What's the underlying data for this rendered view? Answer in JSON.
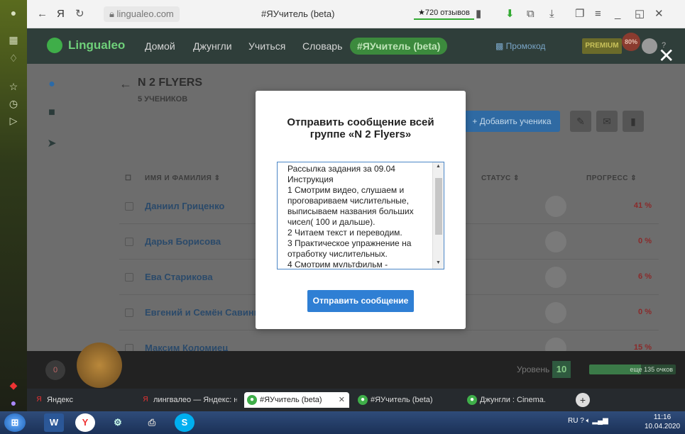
{
  "browser": {
    "url": "lingualeo.com",
    "page_title": "#ЯУчитель (beta)",
    "reviews": "★720 отзывов"
  },
  "nav": {
    "logo": "Lingualeo",
    "links": [
      "Домой",
      "Джунгли",
      "Учиться",
      "Словарь"
    ],
    "teacher": "#ЯУчитель (beta)",
    "promo": "Промокод",
    "premium": "PREMIUM",
    "premium_badge": "80%",
    "help": "?"
  },
  "group": {
    "title": "N 2 FLYERS",
    "subtitle": "5 УЧЕНИКОВ",
    "add_button": "+ Добавить ученика"
  },
  "table": {
    "headers": {
      "name": "ИМЯ И ФАМИЛИЯ",
      "status": "СТАТУС",
      "progress": "ПРОГРЕСС"
    },
    "rows": [
      {
        "name": "Даниил Гриценко",
        "progress": "41 %"
      },
      {
        "name": "Дарья Борисова",
        "progress": "0 %"
      },
      {
        "name": "Ева Старикова",
        "progress": "6 %"
      },
      {
        "name": "Евгений и Семён Савины",
        "progress": "0 %"
      },
      {
        "name": "Максим Коломиец",
        "progress": "15 %"
      }
    ]
  },
  "footer": {
    "zero": "0",
    "level_label": "Уровень",
    "level": "10",
    "progress_text": "еще 135 очков",
    "progress_fraction": 0.6
  },
  "modal": {
    "title": "Отправить сообщение всей группе «N 2 Flyers»",
    "message": "Рассылка задания за 09.04\nИнструкция\n1 Смотрим видео, слушаем и проговариваем числительные, выписываем названия больших чисел( 100 и дальше).\n2 Читаем текст и переводим.\n3 Практическое упражнение на отработку числительных.\n4 Смотрим мультфильм -",
    "send_button": "Отправить сообщение"
  },
  "tabs": [
    {
      "label": "Яндекс",
      "icon": "yandex-icon"
    },
    {
      "label": "лингвалео — Яндекс: нашлось",
      "icon": "yandex-icon"
    },
    {
      "label": "#ЯУчитель (beta)",
      "icon": "lingualeo-icon",
      "active": true
    },
    {
      "label": "#ЯУчитель (beta)",
      "icon": "lingualeo-icon"
    },
    {
      "label": "Джунгли : Cinema.",
      "icon": "lingualeo-icon"
    }
  ],
  "taskbar": {
    "lang": "RU",
    "time": "11:16",
    "date": "10.04.2020"
  },
  "colors": {
    "accent": "#2f7fd4",
    "brand_green": "#3fae49",
    "progress_red": "#8a2a2a"
  }
}
